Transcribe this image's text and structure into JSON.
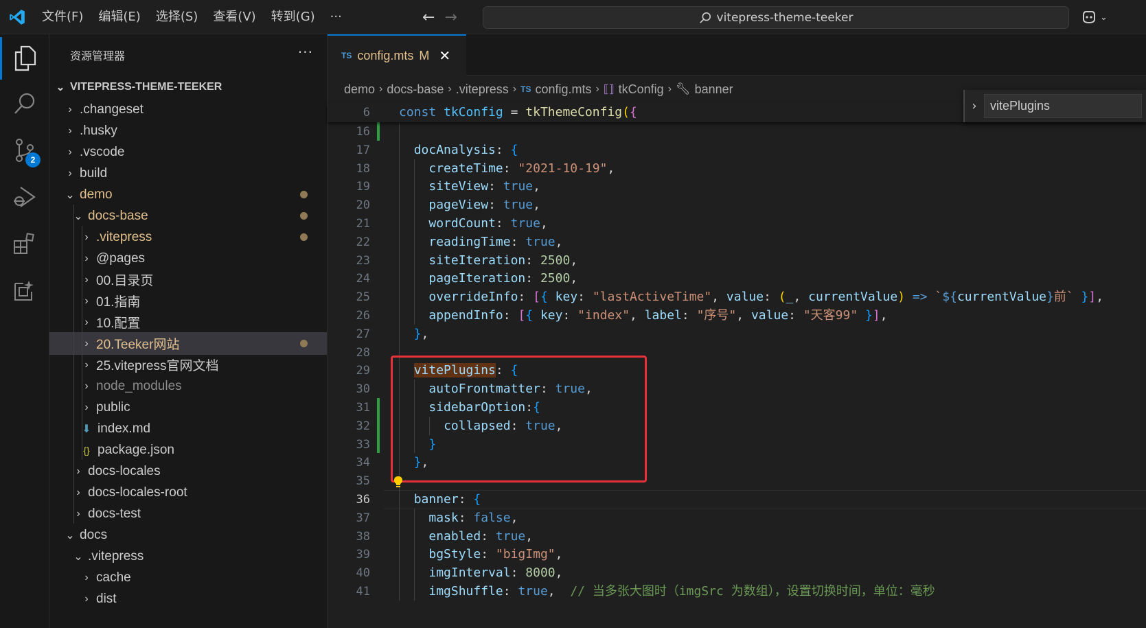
{
  "titlebar": {
    "menu": [
      "文件(F)",
      "编辑(E)",
      "选择(S)",
      "查看(V)",
      "转到(G)",
      "···"
    ],
    "search_text": "vitepress-theme-teeker"
  },
  "activitybar": {
    "items": [
      "explorer-icon",
      "search-icon",
      "source-control-icon",
      "run-debug-icon",
      "extensions-icon",
      "remote-explorer-icon"
    ],
    "scm_badge": "2"
  },
  "sidebar": {
    "title": "资源管理器",
    "more": "···",
    "root": "VITEPRESS-THEME-TEEKER",
    "tree": [
      {
        "label": ".changeset",
        "depth": 1,
        "chev": "›"
      },
      {
        "label": ".husky",
        "depth": 1,
        "chev": "›"
      },
      {
        "label": ".vscode",
        "depth": 1,
        "chev": "›"
      },
      {
        "label": "build",
        "depth": 1,
        "chev": "›"
      },
      {
        "label": "demo",
        "depth": 1,
        "chev": "⌄",
        "mod": true
      },
      {
        "label": "docs-base",
        "depth": 2,
        "chev": "⌄",
        "mod": true
      },
      {
        "label": ".vitepress",
        "depth": 3,
        "chev": "›",
        "mod": true
      },
      {
        "label": "@pages",
        "depth": 3,
        "chev": "›"
      },
      {
        "label": "00.目录页",
        "depth": 3,
        "chev": "›"
      },
      {
        "label": "01.指南",
        "depth": 3,
        "chev": "›"
      },
      {
        "label": "10.配置",
        "depth": 3,
        "chev": "›"
      },
      {
        "label": "20.Teeker网站",
        "depth": 3,
        "chev": "›",
        "mod": true,
        "selected": true
      },
      {
        "label": "25.vitepress官网文档",
        "depth": 3,
        "chev": "›"
      },
      {
        "label": "node_modules",
        "depth": 3,
        "chev": "›",
        "dimmed": true
      },
      {
        "label": "public",
        "depth": 3,
        "chev": "›"
      },
      {
        "label": "index.md",
        "depth": 3,
        "icon": "md"
      },
      {
        "label": "package.json",
        "depth": 3,
        "icon": "json"
      },
      {
        "label": "docs-locales",
        "depth": 2,
        "chev": "›"
      },
      {
        "label": "docs-locales-root",
        "depth": 2,
        "chev": "›"
      },
      {
        "label": "docs-test",
        "depth": 2,
        "chev": "›"
      },
      {
        "label": "docs",
        "depth": 1,
        "chev": "⌄"
      },
      {
        "label": ".vitepress",
        "depth": 2,
        "chev": "⌄"
      },
      {
        "label": "cache",
        "depth": 3,
        "chev": "›"
      },
      {
        "label": "dist",
        "depth": 3,
        "chev": "›"
      }
    ]
  },
  "editor": {
    "tab": {
      "lang": "TS",
      "name": "config.mts",
      "status": "M",
      "close": "✕"
    },
    "breadcrumbs": [
      "demo",
      "docs-base",
      ".vitepress",
      "config.mts",
      "tkConfig",
      "banner"
    ],
    "find_text": "vitePlugins",
    "sticky": {
      "ln": "6",
      "code": "const tkConfig = tkThemeConfig({"
    },
    "lines": [
      {
        "ln": "16",
        "code": ""
      },
      {
        "ln": "17",
        "code": "  docAnalysis: {"
      },
      {
        "ln": "18",
        "code": "    createTime: \"2021-10-19\","
      },
      {
        "ln": "19",
        "code": "    siteView: true,"
      },
      {
        "ln": "20",
        "code": "    pageView: true,"
      },
      {
        "ln": "21",
        "code": "    wordCount: true,"
      },
      {
        "ln": "22",
        "code": "    readingTime: true,"
      },
      {
        "ln": "23",
        "code": "    siteIteration: 2500,"
      },
      {
        "ln": "24",
        "code": "    pageIteration: 2500,"
      },
      {
        "ln": "25",
        "code": "    overrideInfo: [{ key: \"lastActiveTime\", value: (_, currentValue) => `${currentValue}前` }],"
      },
      {
        "ln": "26",
        "code": "    appendInfo: [{ key: \"index\", label: \"序号\", value: \"天客99\" }],"
      },
      {
        "ln": "27",
        "code": "  },"
      },
      {
        "ln": "28",
        "code": ""
      },
      {
        "ln": "29",
        "code": "  vitePlugins: {"
      },
      {
        "ln": "30",
        "code": "    autoFrontmatter: true,"
      },
      {
        "ln": "31",
        "code": "    sidebarOption:{"
      },
      {
        "ln": "32",
        "code": "      collapsed: true,"
      },
      {
        "ln": "33",
        "code": "    }"
      },
      {
        "ln": "34",
        "code": "  },"
      },
      {
        "ln": "35",
        "code": ""
      },
      {
        "ln": "36",
        "code": "  banner: {"
      },
      {
        "ln": "37",
        "code": "    mask: false,"
      },
      {
        "ln": "38",
        "code": "    enabled: true,"
      },
      {
        "ln": "39",
        "code": "    bgStyle: \"bigImg\","
      },
      {
        "ln": "40",
        "code": "    imgInterval: 8000,"
      },
      {
        "ln": "41",
        "code": "    imgShuffle: true,  // 当多张大图时（imgSrc 为数组），设置切换时间，单位：毫秒"
      }
    ],
    "current_line": "36"
  }
}
